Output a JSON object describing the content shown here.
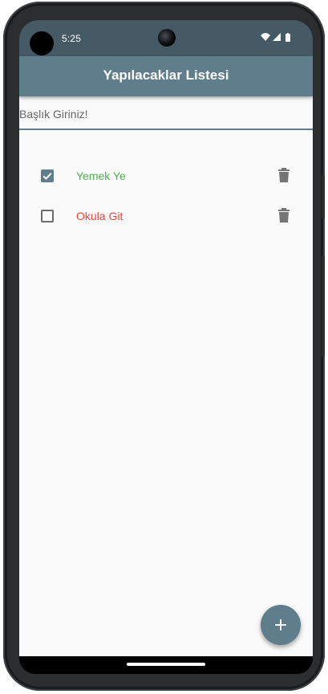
{
  "status_bar": {
    "time": "5:25",
    "icons": [
      "wifi-icon",
      "signal-icon",
      "battery-icon"
    ]
  },
  "app_bar": {
    "title": "Yapılacaklar Listesi"
  },
  "input": {
    "placeholder": "Başlık Giriniz!",
    "value": ""
  },
  "todos": [
    {
      "title": "Yemek Ye",
      "done": true,
      "color": "#4caf50",
      "delete_icon": "trash-icon"
    },
    {
      "title": "Okula Git",
      "done": false,
      "color": "#f44336",
      "delete_icon": "trash-icon"
    }
  ],
  "fab": {
    "icon": "plus-icon"
  },
  "colors": {
    "primary": "#607d8b",
    "primary_dark": "#455a64",
    "done_text": "#4caf50",
    "pending_text": "#f44336"
  }
}
